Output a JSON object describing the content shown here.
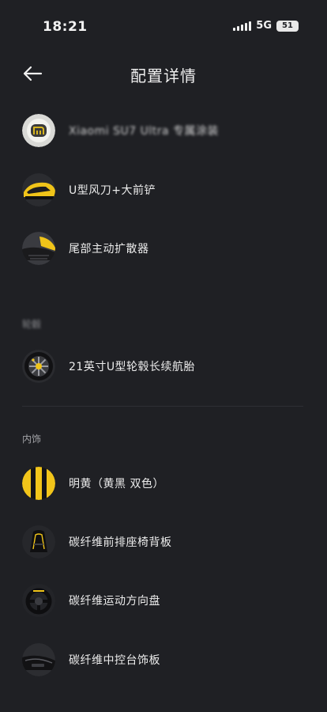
{
  "status_bar": {
    "time": "18:21",
    "network": "5G",
    "battery": "51",
    "signal_icon": "signal-bars-icon"
  },
  "header": {
    "title": "配置详情",
    "back_icon": "arrow-left-icon"
  },
  "exterior": {
    "items": [
      {
        "label": "Xiaomi SU7 Ultra 专属涂装",
        "icon": "brand-badge-thumbnail"
      },
      {
        "label": "U型风刀+大前铲",
        "icon": "front-splitter-thumbnail"
      },
      {
        "label": "尾部主动扩散器",
        "icon": "rear-diffuser-thumbnail"
      }
    ]
  },
  "wheels": {
    "section_title": "轮毂",
    "items": [
      {
        "label": "21英寸U型轮毂长续航胎",
        "icon": "wheel-thumbnail"
      }
    ]
  },
  "interior": {
    "section_title": "内饰",
    "items": [
      {
        "label": "明黄（黄黑 双色）",
        "icon": "yellow-black-color-swatch"
      },
      {
        "label": "碳纤维前排座椅背板",
        "icon": "seat-back-thumbnail"
      },
      {
        "label": "碳纤维运动方向盘",
        "icon": "steering-wheel-thumbnail"
      },
      {
        "label": "碳纤维中控台饰板",
        "icon": "center-console-thumbnail"
      }
    ]
  },
  "colors": {
    "background": "#1f2024",
    "accent_yellow": "#f2c51a",
    "text_primary": "#ececec",
    "text_secondary": "#a3a4a8"
  }
}
